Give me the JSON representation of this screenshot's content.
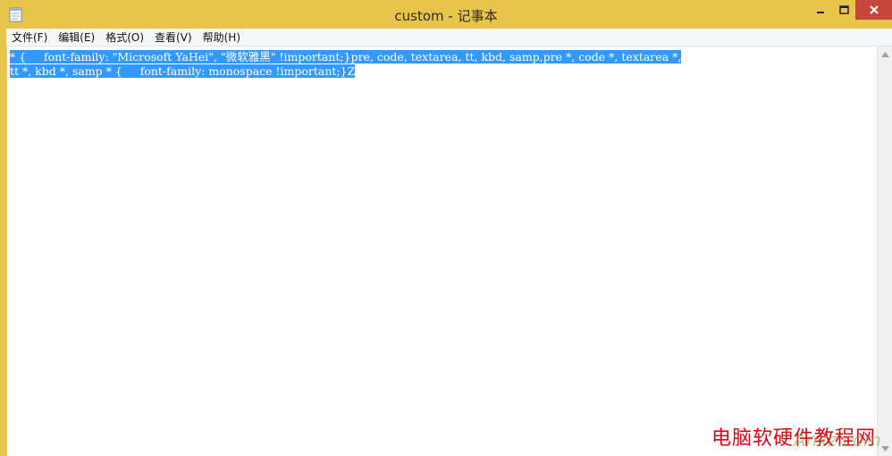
{
  "window": {
    "title": "custom - 记事本",
    "icons": {
      "app": "notepad-icon",
      "minimize": "minimize-icon",
      "maximize": "maximize-icon",
      "close": "close-icon"
    },
    "colors": {
      "titlebar": "#e8c44a",
      "close_button": "#c7453a",
      "selection": "#3399ff"
    }
  },
  "menubar": {
    "items": [
      "文件(F)",
      "编辑(E)",
      "格式(O)",
      "查看(V)",
      "帮助(H)"
    ]
  },
  "editor": {
    "lines": [
      "* {     font-family: \"Microsoft YaHei\", \"微软雅黑\" !important;}pre, code, textarea, tt, kbd, samp,pre *, code *, textarea *,",
      "tt *, kbd *, samp * {     font-family: monospace !important;}Z"
    ],
    "selected": true
  },
  "watermark": {
    "text": "电脑软硬件教程网",
    "overlay": "Anxz.com"
  }
}
